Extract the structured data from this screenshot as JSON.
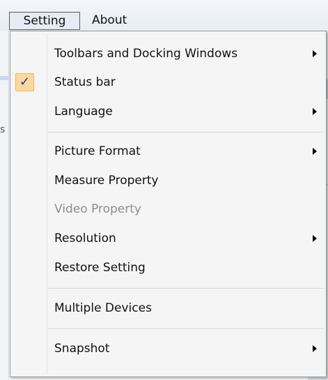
{
  "menubar": {
    "items": [
      {
        "label": "Setting"
      },
      {
        "label": "About"
      }
    ]
  },
  "background": {
    "left_glyph": "s"
  },
  "dropdown": {
    "items": [
      {
        "label": "Toolbars and Docking Windows",
        "submenu": true,
        "checked": false,
        "disabled": false
      },
      {
        "label": "Status bar",
        "submenu": false,
        "checked": true,
        "disabled": false
      },
      {
        "label": "Language",
        "submenu": true,
        "checked": false,
        "disabled": false
      },
      {
        "label": "Picture Format",
        "submenu": true,
        "checked": false,
        "disabled": false
      },
      {
        "label": "Measure Property",
        "submenu": false,
        "checked": false,
        "disabled": false
      },
      {
        "label": "Video Property",
        "submenu": false,
        "checked": false,
        "disabled": true
      },
      {
        "label": "Resolution",
        "submenu": true,
        "checked": false,
        "disabled": false
      },
      {
        "label": "Restore Setting",
        "submenu": false,
        "checked": false,
        "disabled": false
      },
      {
        "label": "Multiple Devices",
        "submenu": false,
        "checked": false,
        "disabled": false
      },
      {
        "label": "Snapshot",
        "submenu": true,
        "checked": false,
        "disabled": false
      }
    ],
    "check_glyph": "✓"
  },
  "colors": {
    "check_highlight": "#fdd89e",
    "check_border": "#f0b260",
    "check_mark": "#1b3f8c",
    "disabled_text": "#8d8d8d"
  }
}
